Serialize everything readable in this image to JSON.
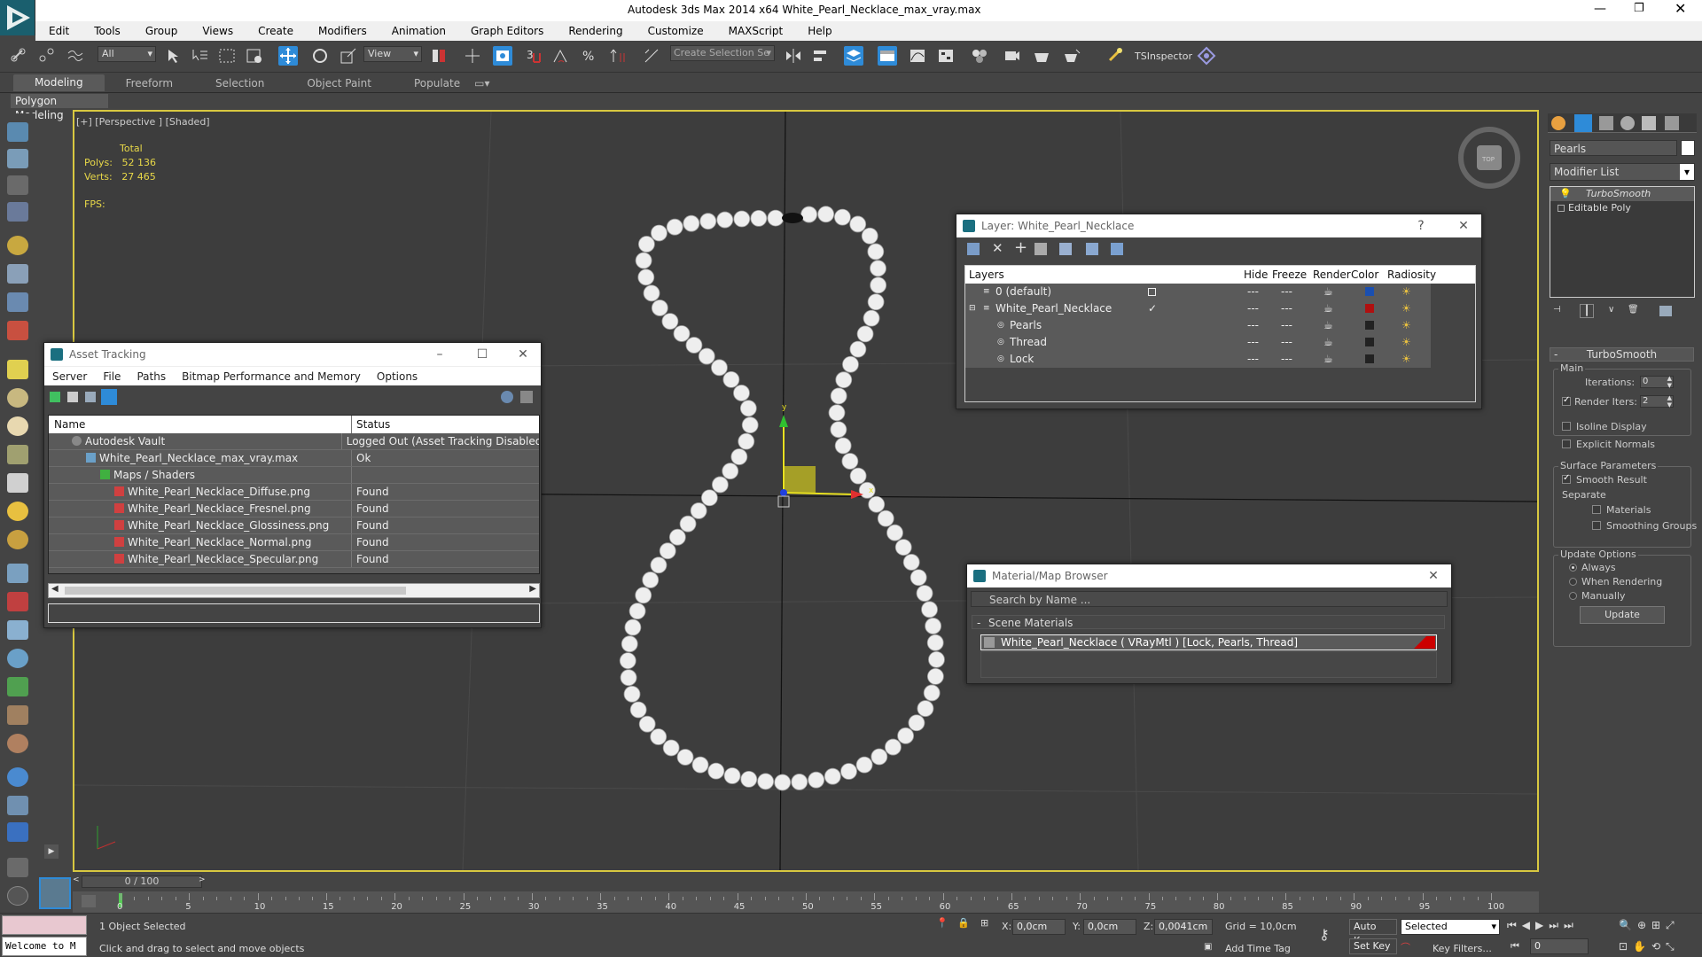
{
  "window": {
    "title": "Autodesk 3ds Max  2014 x64     White_Pearl_Necklace_max_vray.max"
  },
  "menu": [
    "Edit",
    "Tools",
    "Group",
    "Views",
    "Create",
    "Modifiers",
    "Animation",
    "Graph Editors",
    "Rendering",
    "Customize",
    "MAXScript",
    "Help"
  ],
  "toolbar": {
    "filter": "All",
    "refcoord": "View",
    "named_selection": "Create Selection Se",
    "ts_inspector": "TSInspector"
  },
  "ribbon": {
    "tabs": [
      "Modeling",
      "Freeform",
      "Selection",
      "Object Paint",
      "Populate"
    ],
    "panel": "Polygon Modeling"
  },
  "viewport": {
    "label": "[+] [Perspective ] [Shaded]",
    "stats": {
      "total": "Total",
      "polys_label": "Polys:",
      "polys": "52 136",
      "verts_label": "Verts:",
      "verts": "27 465",
      "fps_label": "FPS:"
    }
  },
  "asset_tracking": {
    "title": "Asset Tracking",
    "menu": [
      "Server",
      "File",
      "Paths",
      "Bitmap Performance and Memory",
      "Options"
    ],
    "columns": [
      "Name",
      "Status"
    ],
    "rows": [
      {
        "name": "Autodesk Vault",
        "status": "Logged Out (Asset Tracking Disabled)"
      },
      {
        "name": "White_Pearl_Necklace_max_vray.max",
        "status": "Ok"
      },
      {
        "name": "Maps / Shaders",
        "status": ""
      },
      {
        "name": "White_Pearl_Necklace_Diffuse.png",
        "status": "Found"
      },
      {
        "name": "White_Pearl_Necklace_Fresnel.png",
        "status": "Found"
      },
      {
        "name": "White_Pearl_Necklace_Glossiness.png",
        "status": "Found"
      },
      {
        "name": "White_Pearl_Necklace_Normal.png",
        "status": "Found"
      },
      {
        "name": "White_Pearl_Necklace_Specular.png",
        "status": "Found"
      }
    ]
  },
  "layer_window": {
    "title": "Layer: White_Pearl_Necklace",
    "columns": [
      "Layers",
      "Hide",
      "Freeze",
      "Render",
      "Color",
      "Radiosity"
    ],
    "rows": [
      {
        "name": "0 (default)",
        "color": "#1a4fb0"
      },
      {
        "name": "White_Pearl_Necklace",
        "color": "#b01010"
      },
      {
        "name": "Pearls",
        "color": "#222222"
      },
      {
        "name": "Thread",
        "color": "#222222"
      },
      {
        "name": "Lock",
        "color": "#222222"
      }
    ]
  },
  "material_browser": {
    "title": "Material/Map Browser",
    "search_placeholder": "Search by Name ...",
    "section": "Scene Materials",
    "material": "White_Pearl_Necklace  ( VRayMtl )  [Lock, Pearls, Thread]"
  },
  "command_panel": {
    "object_name": "Pearls",
    "modifier_list": "Modifier List",
    "stack": [
      "TurboSmooth",
      "Editable Poly"
    ],
    "rollout": "TurboSmooth",
    "main_label": "Main",
    "iterations_label": "Iterations:",
    "iterations": "0",
    "render_iters_label": "Render Iters:",
    "render_iters": "2",
    "isoline": "Isoline Display",
    "explicit_normals": "Explicit Normals",
    "surface_params": "Surface Parameters",
    "smooth_result": "Smooth Result",
    "separate": "Separate",
    "materials": "Materials",
    "smoothing_groups": "Smoothing Groups",
    "update_options": "Update Options",
    "always": "Always",
    "when_rendering": "When Rendering",
    "manually": "Manually",
    "update_button": "Update"
  },
  "timeline": {
    "slider": "0 / 100",
    "ticks": [
      "0",
      "5",
      "10",
      "15",
      "20",
      "25",
      "30",
      "35",
      "40",
      "45",
      "50",
      "55",
      "60",
      "65",
      "70",
      "75",
      "80",
      "85",
      "90",
      "95",
      "100"
    ]
  },
  "status": {
    "welcome": "Welcome to M",
    "selected": "1 Object Selected",
    "prompt": "Click and drag to select and move objects",
    "x_label": "X:",
    "x": "0,0cm",
    "y_label": "Y:",
    "y": "0,0cm",
    "z_label": "Z:",
    "z": "0,0041cm",
    "grid": "Grid = 10,0cm",
    "add_time_tag": "Add Time Tag",
    "auto_key": "Auto Key",
    "set_key": "Set Key",
    "selected_dropdown": "Selected",
    "key_filters": "Key Filters...",
    "frame": "0"
  },
  "colors": {
    "accent": "#2e8bd8",
    "viewport_border": "#d8c840",
    "stats_text": "#e8d848"
  }
}
